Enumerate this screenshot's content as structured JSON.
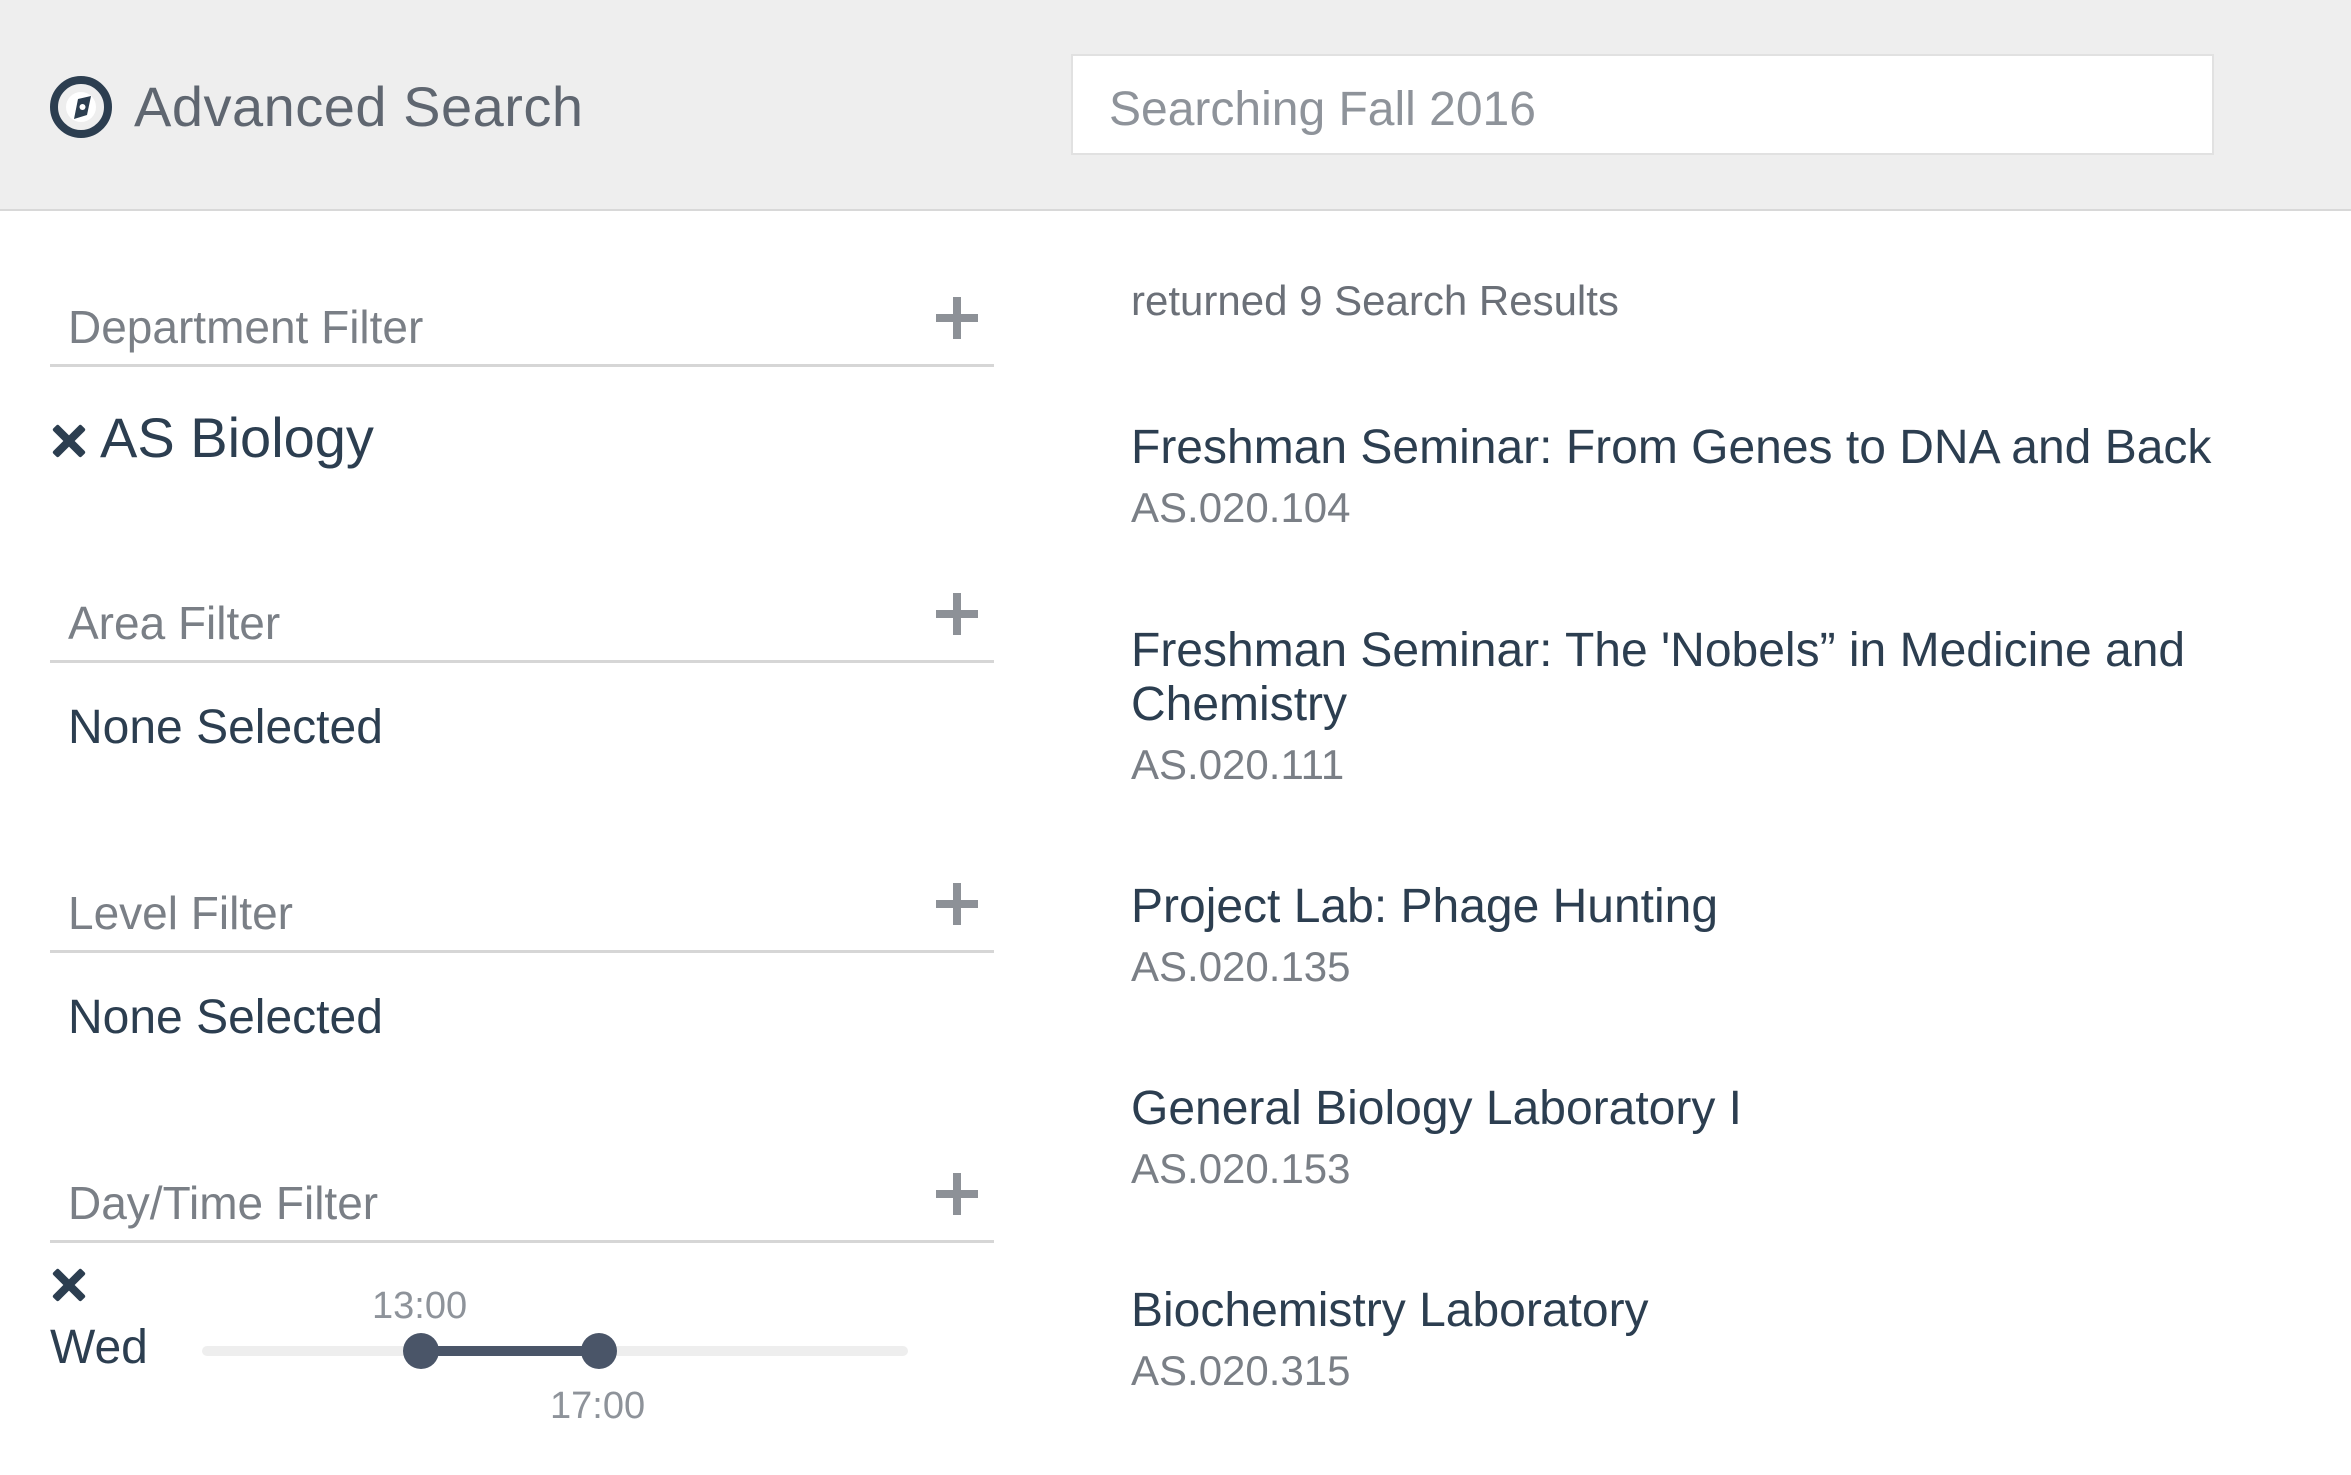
{
  "header": {
    "title": "Advanced Search",
    "search_placeholder": "Searching Fall 2016"
  },
  "filters": {
    "department": {
      "label": "Department Filter",
      "selected": "AS Biology"
    },
    "area": {
      "label": "Area Filter",
      "selected": "None Selected"
    },
    "level": {
      "label": "Level Filter",
      "selected": "None Selected"
    },
    "daytime": {
      "label": "Day/Time Filter",
      "day": "Wed",
      "start": "13:00",
      "end": "17:00"
    }
  },
  "results": {
    "summary": "returned 9 Search Results",
    "items": [
      {
        "title": "Freshman Seminar: From Genes to DNA and Back",
        "code": "AS.020.104"
      },
      {
        "title": "Freshman Seminar: The 'Nobels” in Medicine and Chemistry",
        "code": "AS.020.111"
      },
      {
        "title": "Project Lab: Phage Hunting",
        "code": "AS.020.135"
      },
      {
        "title": "General Biology Laboratory I",
        "code": "AS.020.153"
      },
      {
        "title": "Biochemistry Laboratory",
        "code": "AS.020.315"
      }
    ]
  },
  "icons": {
    "logo": "compass-icon",
    "add": "plus-icon",
    "remove": "x-icon"
  },
  "colors": {
    "header_bg": "#eeeeee",
    "text_primary": "#2c3e50",
    "text_muted": "#7a7f86",
    "accent": "#4a5568"
  }
}
